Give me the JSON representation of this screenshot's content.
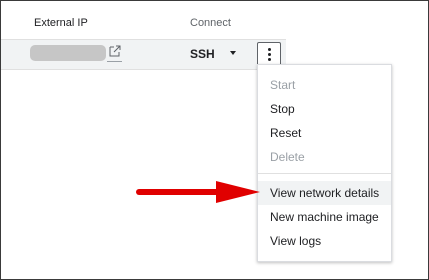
{
  "table": {
    "headers": {
      "external_ip": "External IP",
      "connect": "Connect"
    },
    "row": {
      "connect_label": "SSH"
    }
  },
  "menu": {
    "items": [
      {
        "label": "Start",
        "disabled": true
      },
      {
        "label": "Stop",
        "disabled": false
      },
      {
        "label": "Reset",
        "disabled": false
      },
      {
        "label": "Delete",
        "disabled": true
      },
      {
        "label": "View network details",
        "disabled": false,
        "highlighted": true
      },
      {
        "label": "New machine image",
        "disabled": false
      },
      {
        "label": "View logs",
        "disabled": false
      }
    ]
  },
  "icons": {
    "external_link": "external-link-icon",
    "dropdown": "chevron-down-icon",
    "more_actions": "more-vert-icon",
    "annotation_arrow": "arrow-right-icon"
  },
  "colors": {
    "annotation_arrow": "#e00000",
    "redacted_ip": "#c6c6c6",
    "row_background": "#f1f3f4",
    "disabled_text": "#9aa0a6"
  }
}
